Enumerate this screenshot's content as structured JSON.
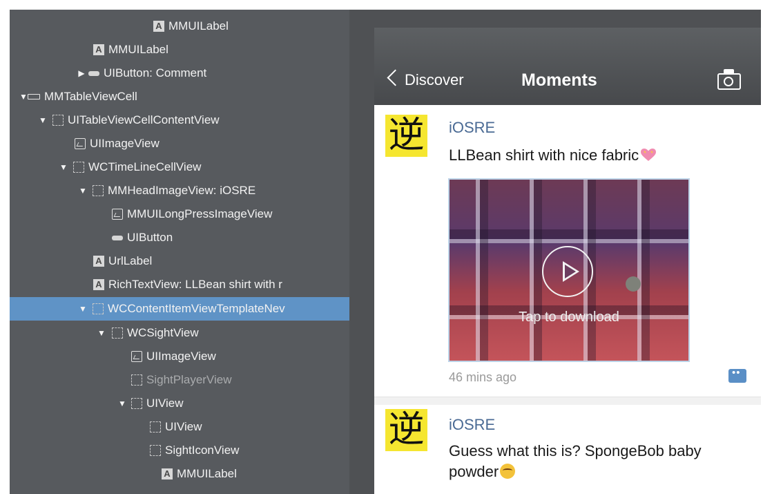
{
  "tree": {
    "items": [
      {
        "label": "MMUILabel",
        "icon": "label-icon",
        "expander": "",
        "selected": false,
        "dim": false
      },
      {
        "label": "MMUILabel",
        "icon": "label-icon",
        "expander": "",
        "selected": false,
        "dim": false
      },
      {
        "label": "UIButton: Comment",
        "icon": "button-icon",
        "expander": "▶",
        "selected": false,
        "dim": false
      },
      {
        "label": "MMTableViewCell",
        "icon": "cell-icon",
        "expander": "▼",
        "selected": false,
        "dim": false
      },
      {
        "label": "UITableViewCellContentView",
        "icon": "view-icon",
        "expander": "▼",
        "selected": false,
        "dim": false
      },
      {
        "label": "UIImageView",
        "icon": "image-icon",
        "expander": "",
        "selected": false,
        "dim": false
      },
      {
        "label": "WCTimeLineCellView",
        "icon": "view-icon",
        "expander": "▼",
        "selected": false,
        "dim": false
      },
      {
        "label": "MMHeadImageView: iOSRE",
        "icon": "view-icon",
        "expander": "▼",
        "selected": false,
        "dim": false
      },
      {
        "label": "MMUILongPressImageView",
        "icon": "image-icon",
        "expander": "",
        "selected": false,
        "dim": false
      },
      {
        "label": "UIButton",
        "icon": "button-icon",
        "expander": "",
        "selected": false,
        "dim": false
      },
      {
        "label": "UrlLabel",
        "icon": "label-icon",
        "expander": "",
        "selected": false,
        "dim": false
      },
      {
        "label": "RichTextView: LLBean shirt with r",
        "icon": "label-icon",
        "expander": "",
        "selected": false,
        "dim": false
      },
      {
        "label": "WCContentItemViewTemplateNev",
        "icon": "view-icon",
        "expander": "▼",
        "selected": true,
        "dim": false
      },
      {
        "label": "WCSightView",
        "icon": "view-icon",
        "expander": "▼",
        "selected": false,
        "dim": false
      },
      {
        "label": "UIImageView",
        "icon": "image-icon",
        "expander": "",
        "selected": false,
        "dim": false
      },
      {
        "label": "SightPlayerView",
        "icon": "view-icon",
        "expander": "",
        "selected": false,
        "dim": true
      },
      {
        "label": "UIView",
        "icon": "view-icon",
        "expander": "▼",
        "selected": false,
        "dim": false
      },
      {
        "label": "UIView",
        "icon": "view-icon",
        "expander": "",
        "selected": false,
        "dim": false
      },
      {
        "label": "SightIconView",
        "icon": "view-icon",
        "expander": "",
        "selected": false,
        "dim": false
      },
      {
        "label": "MMUILabel",
        "icon": "label-icon",
        "expander": "",
        "selected": false,
        "dim": false
      }
    ]
  },
  "phone": {
    "nav": {
      "back_label": "Discover",
      "title": "Moments",
      "camera_icon": "camera-icon"
    },
    "posts": [
      {
        "avatar_glyph": "逆",
        "author": "iOSRE",
        "text": "LLBean shirt with nice fabric",
        "emoji": "sparkling-heart-emoji",
        "video_label": "Tap to download",
        "timestamp": "46 mins ago"
      },
      {
        "avatar_glyph": "逆",
        "author": "iOSRE",
        "text": "Guess what this is? SpongeBob baby powder",
        "emoji": "crying-laughing-emoji"
      }
    ]
  },
  "colors": {
    "tree_background": "#575a5e",
    "selection": "#5f93c6",
    "navbar": "#4f5154",
    "author_link": "#4a6a94",
    "avatar_yellow": "#f5e630"
  }
}
